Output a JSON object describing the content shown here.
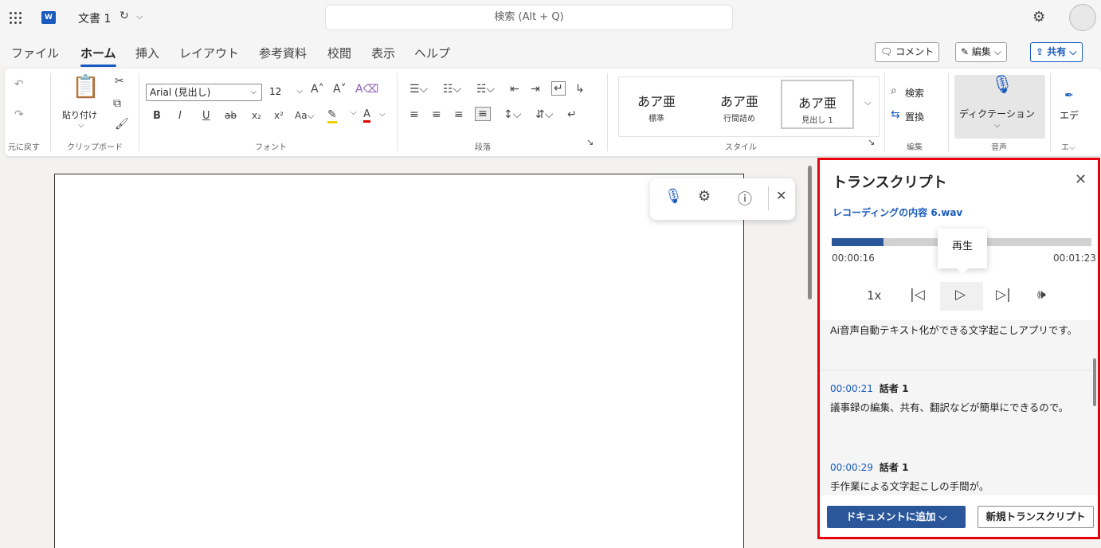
{
  "titlebar": {
    "doc_title": "文書 1",
    "search_placeholder": "検索 (Alt + Q)"
  },
  "tabs": [
    {
      "label": "ファイル"
    },
    {
      "label": "ホーム",
      "active": true
    },
    {
      "label": "挿入"
    },
    {
      "label": "レイアウト"
    },
    {
      "label": "参考資料"
    },
    {
      "label": "校閲"
    },
    {
      "label": "表示"
    },
    {
      "label": "ヘルプ"
    }
  ],
  "actions": {
    "comment": "コメント",
    "edit": "編集",
    "share": "共有"
  },
  "ribbon": {
    "undo_label": "元に戻す",
    "paste_label": "貼り付け",
    "clipboard_label": "クリップボード",
    "font_name": "Arial (見出し)",
    "font_size": "12",
    "font_label": "フォント",
    "paragraph_label": "段落",
    "styles": [
      {
        "preview": "あア亜",
        "name": "標準"
      },
      {
        "preview": "あア亜",
        "name": "行間詰め"
      },
      {
        "preview": "あア亜",
        "name": "見出し 1"
      }
    ],
    "styles_label": "スタイル",
    "search_label": "検索",
    "replace_label": "置換",
    "editing_label": "編集",
    "dictation_label": "ディクテーション",
    "voice_label": "音声",
    "editor_label": "エデ"
  },
  "transcript": {
    "title": "トランスクリプト",
    "recording_label": "レコーディングの内容 6.wav",
    "current_time": "00:00:16",
    "total_time": "00:01:23",
    "progress": 0.2,
    "tooltip": "再生",
    "speed": "1x",
    "first_text": "Ai音声自動テキスト化ができる文字起こしアプリです。",
    "entries": [
      {
        "time": "00:00:21",
        "speaker": "話者 1",
        "text": "議事録の編集、共有、翻訳などが簡単にできるので。"
      },
      {
        "time": "00:00:29",
        "speaker": "話者 1",
        "text": "手作業による文字起こしの手間が。"
      }
    ],
    "add_button": "ドキュメントに追加",
    "new_button": "新規トランスクリプト"
  },
  "colors": {
    "accent": "#185abd",
    "primary_button": "#2b579a",
    "highlight_frame": "#e8000b"
  }
}
